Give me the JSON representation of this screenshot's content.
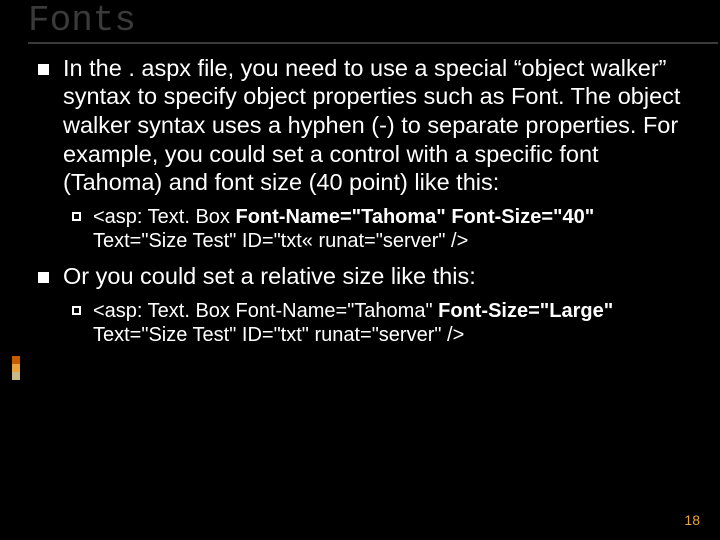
{
  "title": "Fonts",
  "bullets": [
    {
      "level": 1,
      "text": "In the . aspx file, you need to use a special “object walker” syntax to specify object properties such as Font. The object walker syntax uses a hyphen (-) to separate properties. For example, you could set a control with a specific font (Tahoma) and font size (40 point) like this:"
    },
    {
      "level": 2,
      "pre": "<asp: Text. Box ",
      "bold": "Font-Name=\"Tahoma\" Font-Size=\"40\"",
      "post": " Text=\"Size Test\" ID=\"txt« runat=\"server\" />"
    },
    {
      "level": 1,
      "text": "Or you could set a relative size like this:"
    },
    {
      "level": 2,
      "pre": "<asp: Text. Box Font-Name=\"Tahoma\" ",
      "bold": "Font-Size=\"Large\"",
      "post": " Text=\"Size Test\"  ID=\"txt\" runat=\"server\" />"
    }
  ],
  "page_number": "18"
}
